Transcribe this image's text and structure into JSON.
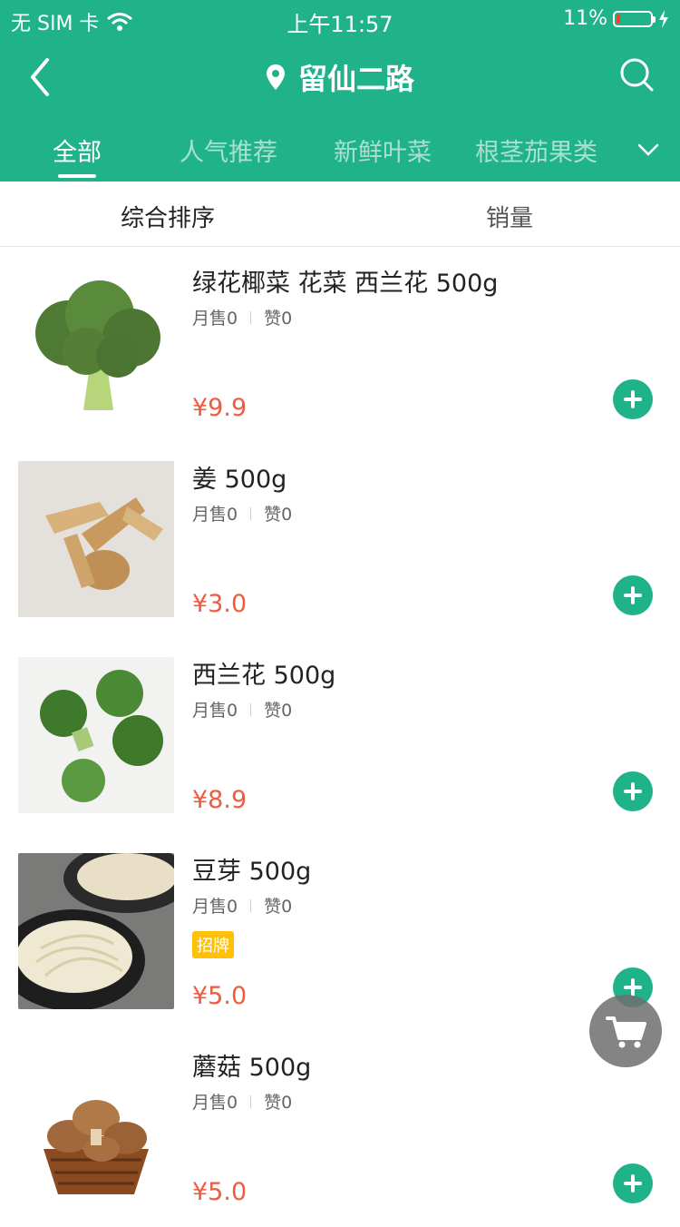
{
  "status_bar": {
    "carrier": "无 SIM 卡",
    "time": "上午11:57",
    "battery": "11%",
    "battery_level": 0.11
  },
  "nav": {
    "title": "留仙二路"
  },
  "tabs": [
    {
      "label": "全部",
      "active": true
    },
    {
      "label": "人气推荐",
      "active": false
    },
    {
      "label": "新鲜叶菜",
      "active": false
    },
    {
      "label": "根茎茄果类",
      "active": false
    }
  ],
  "sort": {
    "default": "综合排序",
    "sales": "销量"
  },
  "products": [
    {
      "name": "绿花椰菜 花菜  西兰花 500g",
      "monthly_sales": "月售0",
      "likes": "赞0",
      "price": "¥9.9",
      "badge": ""
    },
    {
      "name": "姜 500g",
      "monthly_sales": "月售0",
      "likes": "赞0",
      "price": "¥3.0",
      "badge": ""
    },
    {
      "name": "西兰花 500g",
      "monthly_sales": "月售0",
      "likes": "赞0",
      "price": "¥8.9",
      "badge": ""
    },
    {
      "name": "豆芽 500g",
      "monthly_sales": "月售0",
      "likes": "赞0",
      "price": "¥5.0",
      "badge": "招牌"
    },
    {
      "name": "蘑菇 500g",
      "monthly_sales": "月售0",
      "likes": "赞0",
      "price": "¥5.0",
      "badge": ""
    }
  ],
  "colors": {
    "brand": "#20b38a",
    "price": "#f05a3d",
    "badge": "#ffc107"
  }
}
